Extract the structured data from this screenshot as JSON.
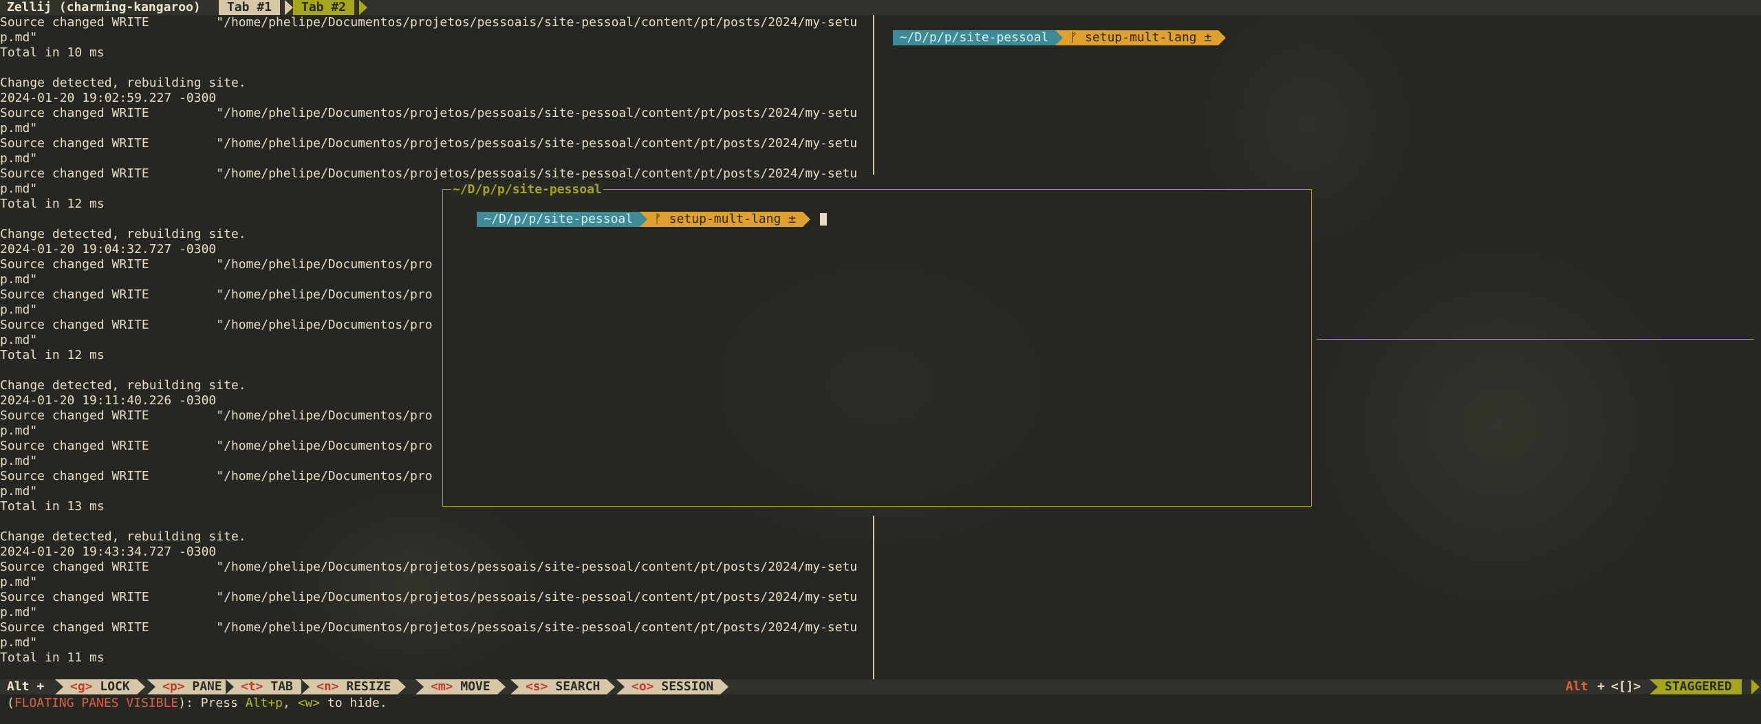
{
  "session": {
    "title": "Zellij (charming-kangaroo)"
  },
  "tabs": [
    {
      "label": "Tab #1"
    },
    {
      "label": "Tab #2"
    }
  ],
  "left_pane": {
    "lines_top": [
      "Source changed WRITE         \"/home/phelipe/Documentos/projetos/pessoais/site-pessoal/content/pt/posts/2024/my-setu",
      "p.md\"",
      "Total in 10 ms",
      "",
      "Change detected, rebuilding site.",
      "2024-01-20 19:02:59.227 -0300",
      "Source changed WRITE         \"/home/phelipe/Documentos/projetos/pessoais/site-pessoal/content/pt/posts/2024/my-setu",
      "p.md\"",
      "Source changed WRITE         \"/home/phelipe/Documentos/projetos/pessoais/site-pessoal/content/pt/posts/2024/my-setu",
      "p.md\"",
      "Source changed WRITE         \"/home/phelipe/Documentos/projetos/pessoais/site-pessoal/content/pt/posts/2024/my-setu",
      "p.md\"",
      "Total in 12 ms",
      "",
      "Change detected, rebuilding site.",
      "2024-01-20 19:04:32.727 -0300",
      "Source changed WRITE         \"/home/phelipe/Documentos/pro",
      "p.md\"",
      "Source changed WRITE         \"/home/phelipe/Documentos/pro",
      "p.md\"",
      "Source changed WRITE         \"/home/phelipe/Documentos/pro",
      "p.md\"",
      "Total in 12 ms",
      "",
      "Change detected, rebuilding site.",
      "2024-01-20 19:11:40.226 -0300",
      "Source changed WRITE         \"/home/phelipe/Documentos/pro",
      "p.md\"",
      "Source changed WRITE         \"/home/phelipe/Documentos/pro",
      "p.md\"",
      "Source changed WRITE         \"/home/phelipe/Documentos/pro",
      "p.md\"",
      "Total in 13 ms",
      "",
      "Change detected, rebuilding site.",
      "2024-01-20 19:43:34.727 -0300",
      "Source changed WRITE         \"/home/phelipe/Documentos/projetos/pessoais/site-pessoal/content/pt/posts/2024/my-setu",
      "p.md\"",
      "Source changed WRITE         \"/home/phelipe/Documentos/projetos/pessoais/site-pessoal/content/pt/posts/2024/my-setu",
      "p.md\"",
      "Source changed WRITE         \"/home/phelipe/Documentos/projetos/pessoais/site-pessoal/content/pt/posts/2024/my-setu",
      "p.md\"",
      "Total in 11 ms"
    ]
  },
  "right_pane": {
    "prompt_path": "~/D/p/p/site-pessoal",
    "prompt_branch": "ᚠ setup-mult-lang ±"
  },
  "floating_pane": {
    "title": "~/D/p/p/site-pessoal",
    "prompt_path": "~/D/p/p/site-pessoal",
    "prompt_branch": "ᚠ setup-mult-lang ±"
  },
  "status_bar": {
    "modifier": "Alt +",
    "keys": [
      {
        "key": "<g>",
        "label": "LOCK"
      },
      {
        "key": "<p>",
        "label": "PANE"
      },
      {
        "key": "<t>",
        "label": "TAB"
      },
      {
        "key": "<n>",
        "label": "RESIZE"
      },
      {
        "key": "<m>",
        "label": "MOVE"
      },
      {
        "key": "<s>",
        "label": "SEARCH"
      },
      {
        "key": "<o>",
        "label": "SESSION"
      }
    ],
    "right_alt": "Alt",
    "right_plus": "+",
    "right_keys": "<[]>",
    "layout": "STAGGERED"
  },
  "hint": {
    "open": "(",
    "mode": "FLOATING PANES VISIBLE",
    "mid1": "): Press ",
    "combo": "Alt+p",
    "mid2": ", ",
    "key2": "<w>",
    "end": " to hide."
  },
  "colors": {
    "accent": "#a5a51e",
    "tab_bg": "#d6c7a8",
    "path_bg": "#3e8a96",
    "branch_bg": "#e0a030",
    "key_red": "#c0392b"
  }
}
